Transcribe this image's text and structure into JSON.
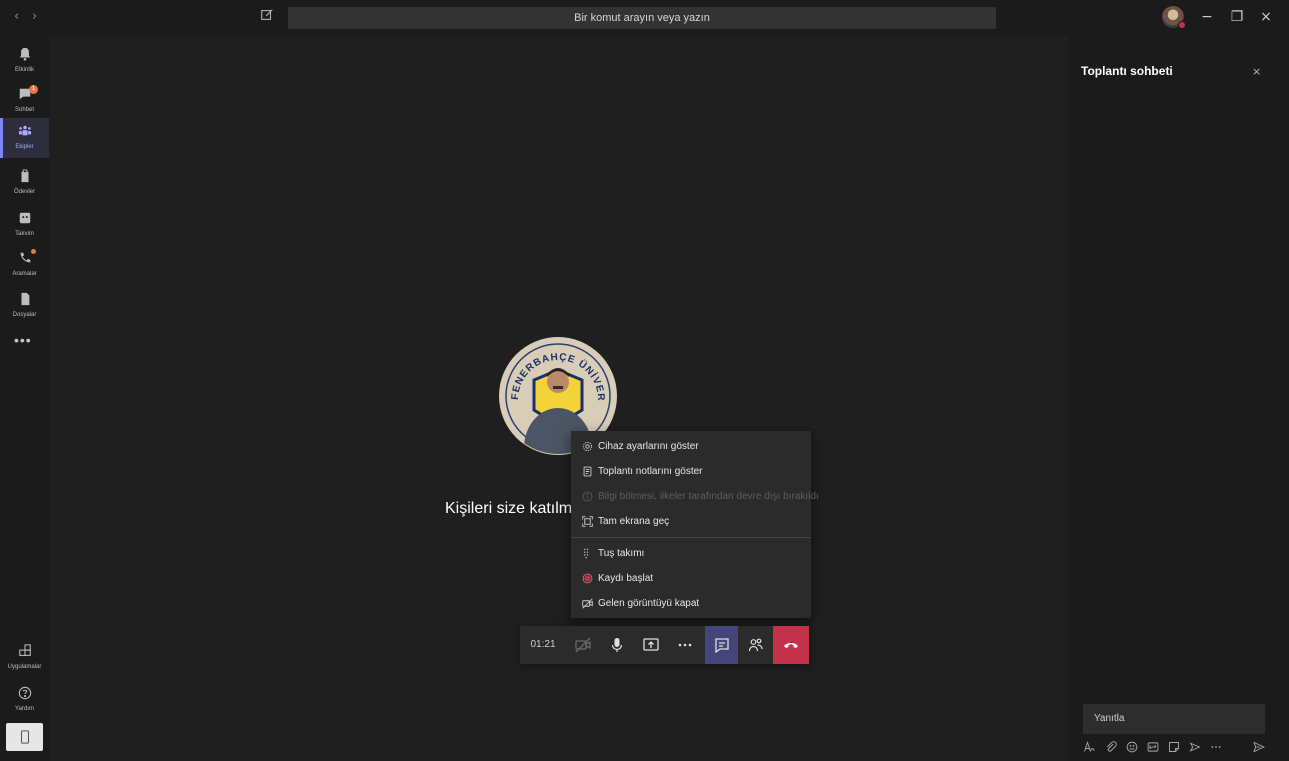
{
  "titlebar": {
    "back": "‹",
    "forward": "›",
    "search_placeholder": "Bir komut arayın veya yazın",
    "minimize": "−",
    "restore": "❐",
    "close": "×"
  },
  "rail": {
    "items": [
      {
        "label": "Etkinlik",
        "icon": "bell-icon"
      },
      {
        "label": "Sohbet",
        "icon": "chat-icon",
        "badge": "1"
      },
      {
        "label": "Ekipler",
        "icon": "teams-icon",
        "active": true
      },
      {
        "label": "Ödevler",
        "icon": "assignments-icon"
      },
      {
        "label": "Takvim",
        "icon": "calendar-icon"
      },
      {
        "label": "Aramalar",
        "icon": "phone-icon",
        "dot": true
      },
      {
        "label": "Dosyalar",
        "icon": "file-icon"
      }
    ],
    "more": "•••",
    "apps_label": "Uygulamalar",
    "help_label": "Yardım"
  },
  "stage": {
    "invite_text": "Kişileri size katılmaya davet edin",
    "logo_text": "FENERBAHÇE ÜNİVERSİTESİ"
  },
  "more_menu": {
    "items": [
      {
        "label": "Cihaz ayarlarını göster",
        "icon": "gear-icon"
      },
      {
        "label": "Toplantı notlarını göster",
        "icon": "notes-icon"
      },
      {
        "label": "Bilgi bölmesi, ilkeler tarafından devre dışı bırakıldı",
        "icon": "info-icon",
        "disabled": true
      },
      {
        "label": "Tam ekrana geç",
        "icon": "fullscreen-icon"
      },
      {
        "label": "Tuş takımı",
        "icon": "keypad-icon"
      },
      {
        "label": "Kaydı başlat",
        "icon": "record-icon"
      },
      {
        "label": "Gelen görüntüyü kapat",
        "icon": "video-off-icon"
      }
    ]
  },
  "call_bar": {
    "timer": "01:21"
  },
  "chat": {
    "title": "Toplantı sohbeti",
    "close": "×",
    "reply_placeholder": "Yanıtla"
  },
  "colors": {
    "accent": "#7f85f5",
    "hangup": "#c4314b",
    "badge": "#e97548",
    "background": "#1f1f1f"
  }
}
